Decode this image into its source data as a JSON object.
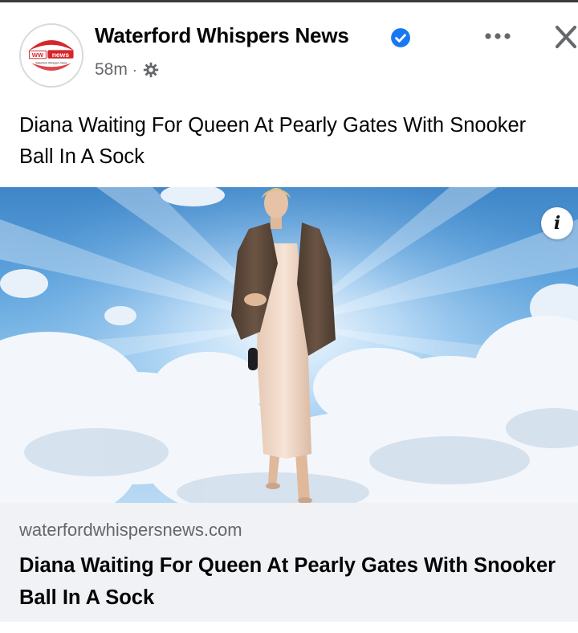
{
  "post": {
    "page_name": "Waterford Whispers News",
    "timestamp": "58m",
    "separator": "·",
    "privacy_icon": "gear-icon",
    "verified_icon": "verified-badge-icon",
    "more_icon": "more-options-icon",
    "close_icon": "close-icon",
    "text": "Diana Waiting For Queen At Pearly Gates With Snooker Ball In A Sock"
  },
  "avatar": {
    "logo_text_ww": "WW",
    "logo_text_news": "news",
    "logo_subtext": "Waterford Whispers News"
  },
  "image": {
    "info_label": "i",
    "info_icon": "info-icon"
  },
  "link": {
    "domain": "waterfordwhispersnews.com",
    "title": "Diana Waiting For Queen At Pearly Gates With Snooker Ball In A Sock"
  },
  "colors": {
    "verified_blue": "#1877f2",
    "secondary_text": "#65676b",
    "card_bg": "#f0f2f5",
    "brand_red": "#d7262b"
  }
}
